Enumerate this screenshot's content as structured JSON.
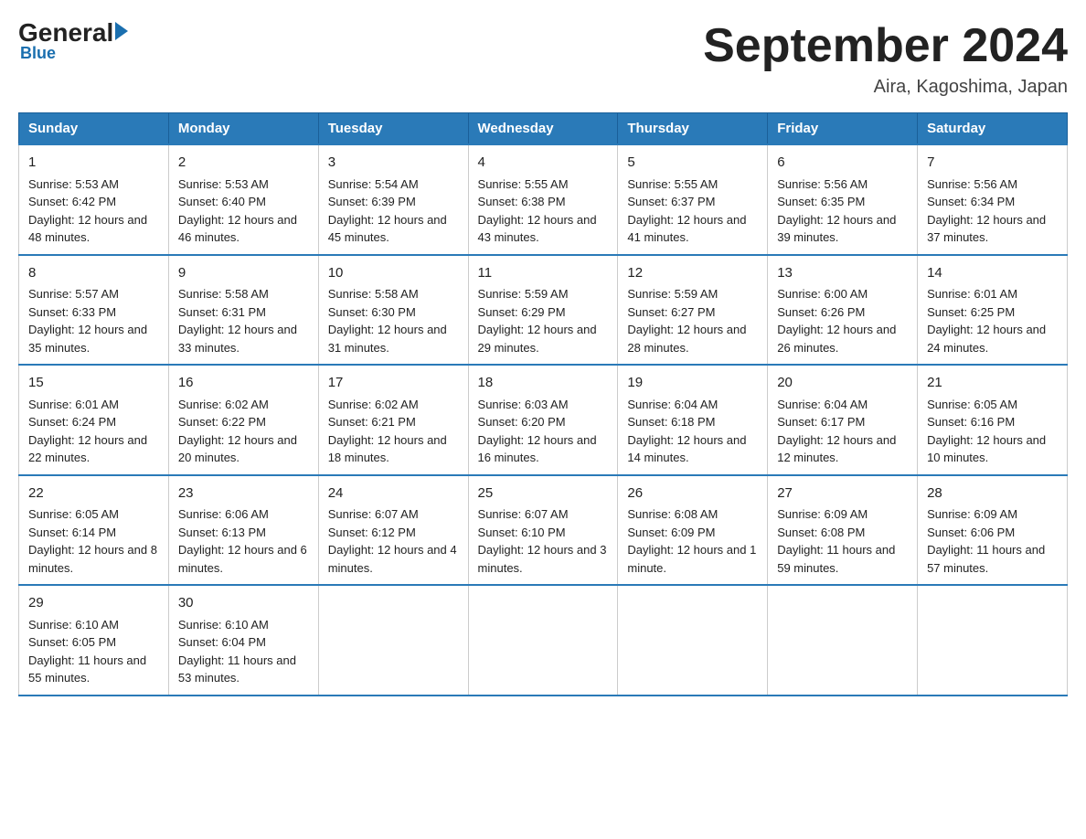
{
  "logo": {
    "general": "General",
    "blue": "Blue"
  },
  "header": {
    "title": "September 2024",
    "subtitle": "Aira, Kagoshima, Japan"
  },
  "weekdays": [
    "Sunday",
    "Monday",
    "Tuesday",
    "Wednesday",
    "Thursday",
    "Friday",
    "Saturday"
  ],
  "weeks": [
    [
      {
        "day": "1",
        "sunrise": "Sunrise: 5:53 AM",
        "sunset": "Sunset: 6:42 PM",
        "daylight": "Daylight: 12 hours and 48 minutes."
      },
      {
        "day": "2",
        "sunrise": "Sunrise: 5:53 AM",
        "sunset": "Sunset: 6:40 PM",
        "daylight": "Daylight: 12 hours and 46 minutes."
      },
      {
        "day": "3",
        "sunrise": "Sunrise: 5:54 AM",
        "sunset": "Sunset: 6:39 PM",
        "daylight": "Daylight: 12 hours and 45 minutes."
      },
      {
        "day": "4",
        "sunrise": "Sunrise: 5:55 AM",
        "sunset": "Sunset: 6:38 PM",
        "daylight": "Daylight: 12 hours and 43 minutes."
      },
      {
        "day": "5",
        "sunrise": "Sunrise: 5:55 AM",
        "sunset": "Sunset: 6:37 PM",
        "daylight": "Daylight: 12 hours and 41 minutes."
      },
      {
        "day": "6",
        "sunrise": "Sunrise: 5:56 AM",
        "sunset": "Sunset: 6:35 PM",
        "daylight": "Daylight: 12 hours and 39 minutes."
      },
      {
        "day": "7",
        "sunrise": "Sunrise: 5:56 AM",
        "sunset": "Sunset: 6:34 PM",
        "daylight": "Daylight: 12 hours and 37 minutes."
      }
    ],
    [
      {
        "day": "8",
        "sunrise": "Sunrise: 5:57 AM",
        "sunset": "Sunset: 6:33 PM",
        "daylight": "Daylight: 12 hours and 35 minutes."
      },
      {
        "day": "9",
        "sunrise": "Sunrise: 5:58 AM",
        "sunset": "Sunset: 6:31 PM",
        "daylight": "Daylight: 12 hours and 33 minutes."
      },
      {
        "day": "10",
        "sunrise": "Sunrise: 5:58 AM",
        "sunset": "Sunset: 6:30 PM",
        "daylight": "Daylight: 12 hours and 31 minutes."
      },
      {
        "day": "11",
        "sunrise": "Sunrise: 5:59 AM",
        "sunset": "Sunset: 6:29 PM",
        "daylight": "Daylight: 12 hours and 29 minutes."
      },
      {
        "day": "12",
        "sunrise": "Sunrise: 5:59 AM",
        "sunset": "Sunset: 6:27 PM",
        "daylight": "Daylight: 12 hours and 28 minutes."
      },
      {
        "day": "13",
        "sunrise": "Sunrise: 6:00 AM",
        "sunset": "Sunset: 6:26 PM",
        "daylight": "Daylight: 12 hours and 26 minutes."
      },
      {
        "day": "14",
        "sunrise": "Sunrise: 6:01 AM",
        "sunset": "Sunset: 6:25 PM",
        "daylight": "Daylight: 12 hours and 24 minutes."
      }
    ],
    [
      {
        "day": "15",
        "sunrise": "Sunrise: 6:01 AM",
        "sunset": "Sunset: 6:24 PM",
        "daylight": "Daylight: 12 hours and 22 minutes."
      },
      {
        "day": "16",
        "sunrise": "Sunrise: 6:02 AM",
        "sunset": "Sunset: 6:22 PM",
        "daylight": "Daylight: 12 hours and 20 minutes."
      },
      {
        "day": "17",
        "sunrise": "Sunrise: 6:02 AM",
        "sunset": "Sunset: 6:21 PM",
        "daylight": "Daylight: 12 hours and 18 minutes."
      },
      {
        "day": "18",
        "sunrise": "Sunrise: 6:03 AM",
        "sunset": "Sunset: 6:20 PM",
        "daylight": "Daylight: 12 hours and 16 minutes."
      },
      {
        "day": "19",
        "sunrise": "Sunrise: 6:04 AM",
        "sunset": "Sunset: 6:18 PM",
        "daylight": "Daylight: 12 hours and 14 minutes."
      },
      {
        "day": "20",
        "sunrise": "Sunrise: 6:04 AM",
        "sunset": "Sunset: 6:17 PM",
        "daylight": "Daylight: 12 hours and 12 minutes."
      },
      {
        "day": "21",
        "sunrise": "Sunrise: 6:05 AM",
        "sunset": "Sunset: 6:16 PM",
        "daylight": "Daylight: 12 hours and 10 minutes."
      }
    ],
    [
      {
        "day": "22",
        "sunrise": "Sunrise: 6:05 AM",
        "sunset": "Sunset: 6:14 PM",
        "daylight": "Daylight: 12 hours and 8 minutes."
      },
      {
        "day": "23",
        "sunrise": "Sunrise: 6:06 AM",
        "sunset": "Sunset: 6:13 PM",
        "daylight": "Daylight: 12 hours and 6 minutes."
      },
      {
        "day": "24",
        "sunrise": "Sunrise: 6:07 AM",
        "sunset": "Sunset: 6:12 PM",
        "daylight": "Daylight: 12 hours and 4 minutes."
      },
      {
        "day": "25",
        "sunrise": "Sunrise: 6:07 AM",
        "sunset": "Sunset: 6:10 PM",
        "daylight": "Daylight: 12 hours and 3 minutes."
      },
      {
        "day": "26",
        "sunrise": "Sunrise: 6:08 AM",
        "sunset": "Sunset: 6:09 PM",
        "daylight": "Daylight: 12 hours and 1 minute."
      },
      {
        "day": "27",
        "sunrise": "Sunrise: 6:09 AM",
        "sunset": "Sunset: 6:08 PM",
        "daylight": "Daylight: 11 hours and 59 minutes."
      },
      {
        "day": "28",
        "sunrise": "Sunrise: 6:09 AM",
        "sunset": "Sunset: 6:06 PM",
        "daylight": "Daylight: 11 hours and 57 minutes."
      }
    ],
    [
      {
        "day": "29",
        "sunrise": "Sunrise: 6:10 AM",
        "sunset": "Sunset: 6:05 PM",
        "daylight": "Daylight: 11 hours and 55 minutes."
      },
      {
        "day": "30",
        "sunrise": "Sunrise: 6:10 AM",
        "sunset": "Sunset: 6:04 PM",
        "daylight": "Daylight: 11 hours and 53 minutes."
      },
      null,
      null,
      null,
      null,
      null
    ]
  ]
}
